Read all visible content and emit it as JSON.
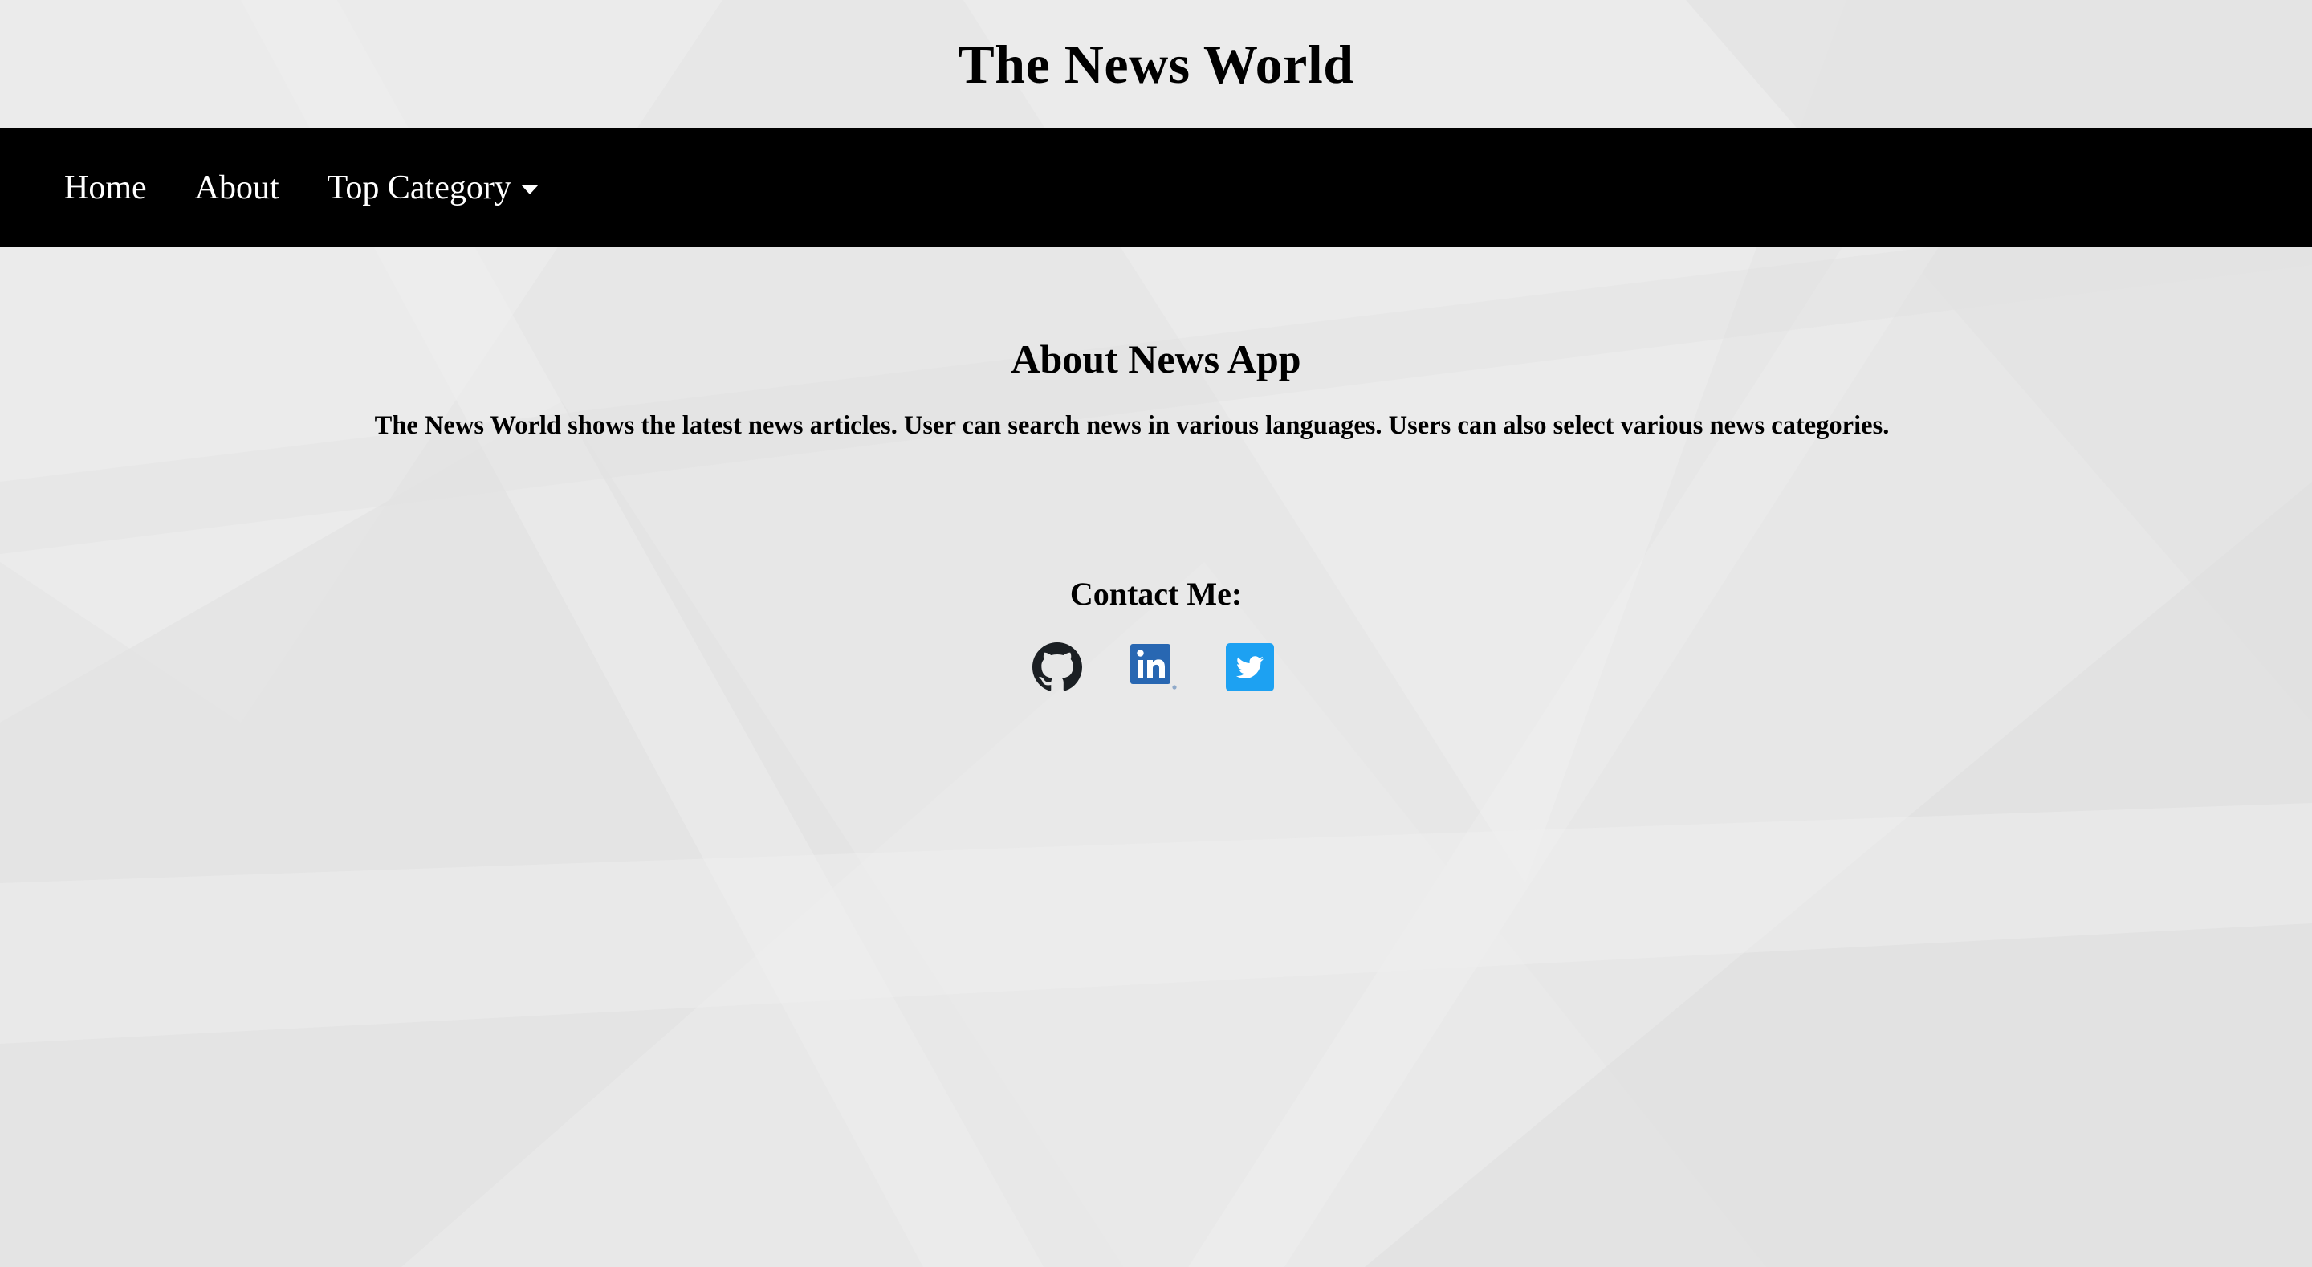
{
  "site": {
    "title": "The News World"
  },
  "nav": {
    "items": [
      {
        "label": "Home"
      },
      {
        "label": "About"
      },
      {
        "label": "Top Category",
        "has_dropdown": true
      }
    ]
  },
  "about": {
    "heading": "About News App",
    "description": "The News World shows the latest news articles. User can search news in various languages. Users can also select various news categories."
  },
  "contact": {
    "heading": "Contact Me:",
    "links": [
      {
        "icon": "github-icon",
        "color": "#1b1f23"
      },
      {
        "icon": "linkedin-icon",
        "color": "#2867b2"
      },
      {
        "icon": "twitter-icon",
        "color": "#1da1f2"
      }
    ]
  },
  "colors": {
    "navbar_bg": "#000000",
    "nav_text": "#ffffff",
    "page_bg": "#e6e6e6"
  }
}
